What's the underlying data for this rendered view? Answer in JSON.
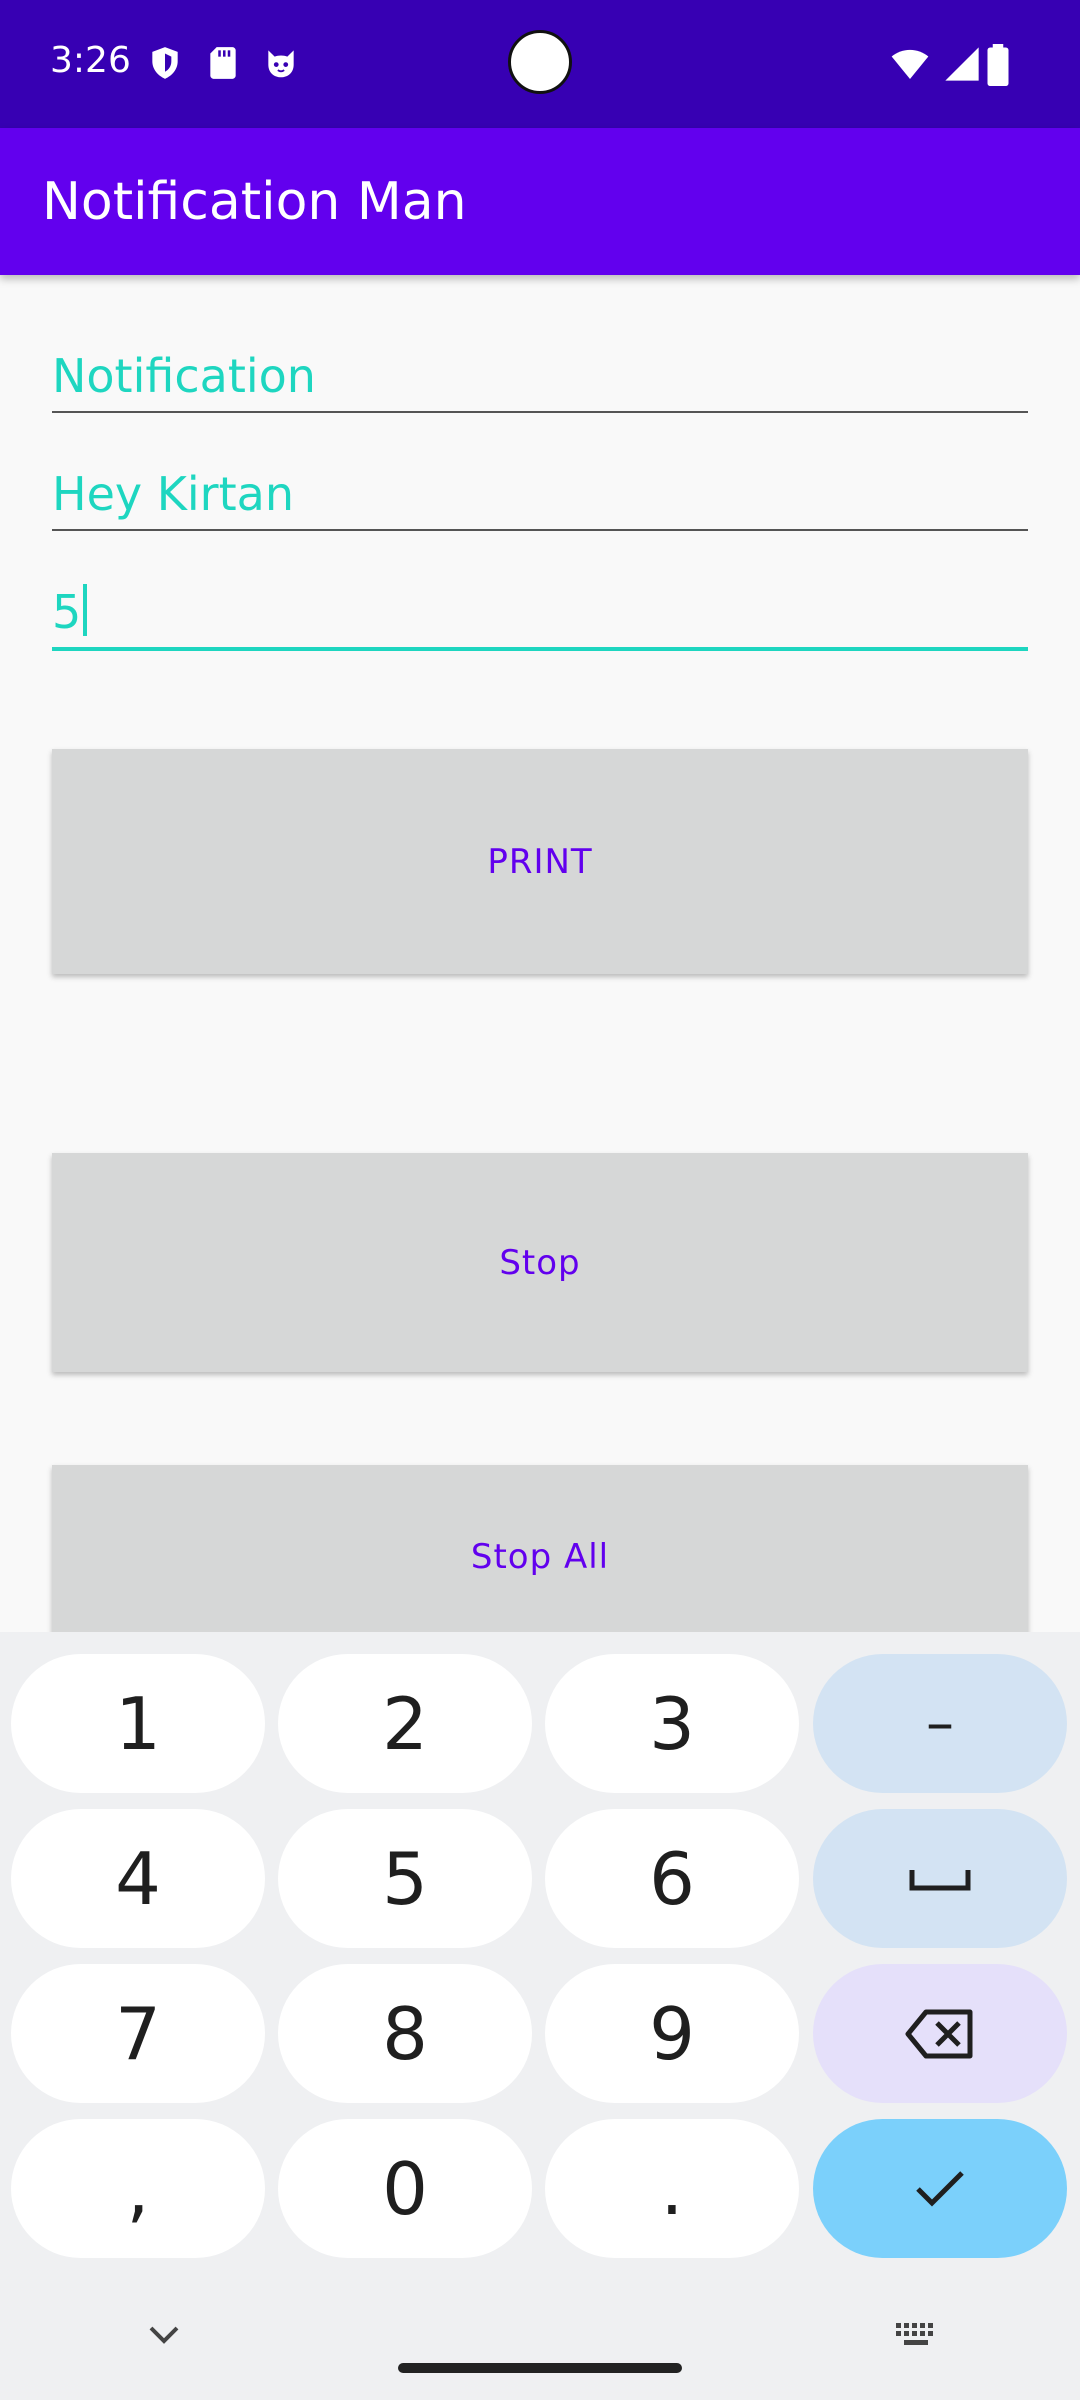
{
  "status_bar": {
    "time": "3:26",
    "icons": [
      "shield-icon",
      "sd-card-icon",
      "cat-face-icon",
      "wifi-icon",
      "signal-icon",
      "battery-icon"
    ]
  },
  "app_bar": {
    "title": "Notification Man"
  },
  "fields": {
    "title_value": "Notification",
    "message_value": "Hey Kirtan",
    "count_value": "5"
  },
  "buttons": {
    "print": "PRINT",
    "stop": "Stop",
    "stop_all": "Stop All"
  },
  "keyboard": {
    "keys": [
      "1",
      "2",
      "3",
      "–",
      "4",
      "5",
      "6",
      "␣",
      "7",
      "8",
      "9",
      "⌫",
      ",",
      "0",
      ".",
      "✓"
    ]
  },
  "colors": {
    "status_bar": "#3700b3",
    "app_bar": "#6200ee",
    "accent": "#1ed6c0",
    "button_bg": "#d6d7d7",
    "button_text": "#6200ee"
  }
}
